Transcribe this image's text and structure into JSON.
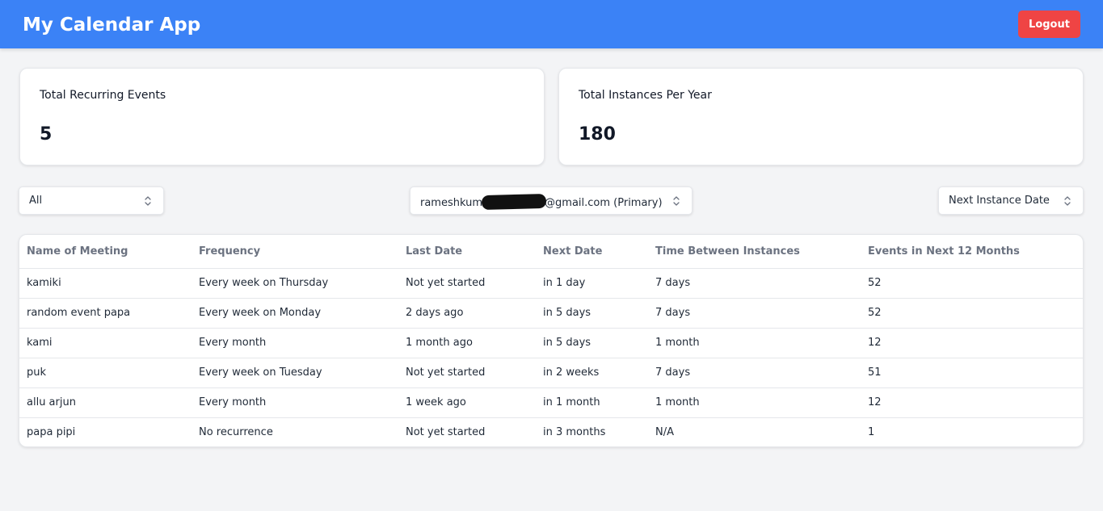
{
  "header": {
    "title": "My Calendar App",
    "logout_label": "Logout"
  },
  "stats": {
    "recurring_label": "Total Recurring Events",
    "recurring_value": "5",
    "instances_label": "Total Instances Per Year",
    "instances_value": "180"
  },
  "filters": {
    "event_filter": "All",
    "calendar_prefix": "rameshkum",
    "calendar_suffix": "@gmail.com (Primary)",
    "sort_by": "Next Instance Date"
  },
  "table": {
    "columns": [
      "Name of Meeting",
      "Frequency",
      "Last Date",
      "Next Date",
      "Time Between Instances",
      "Events in Next 12 Months"
    ],
    "rows": [
      [
        "kamiki",
        "Every week on Thursday",
        "Not yet started",
        "in 1 day",
        "7 days",
        "52"
      ],
      [
        "random event papa",
        "Every week on Monday",
        "2 days ago",
        "in 5 days",
        "7 days",
        "52"
      ],
      [
        "kami",
        "Every month",
        "1 month ago",
        "in 5 days",
        "1 month",
        "12"
      ],
      [
        "puk",
        "Every week on Tuesday",
        "Not yet started",
        "in 2 weeks",
        "7 days",
        "51"
      ],
      [
        "allu arjun",
        "Every month",
        "1 week ago",
        "in 1 month",
        "1 month",
        "12"
      ],
      [
        "papa pipi",
        "No recurrence",
        "Not yet started",
        "in 3 months",
        "N/A",
        "1"
      ]
    ]
  },
  "colors": {
    "header_bg": "#3b82f6",
    "logout_bg": "#ef4444",
    "page_bg": "#f3f4f6"
  },
  "icons": {
    "select_chevron": "chevron-up-down-icon"
  }
}
